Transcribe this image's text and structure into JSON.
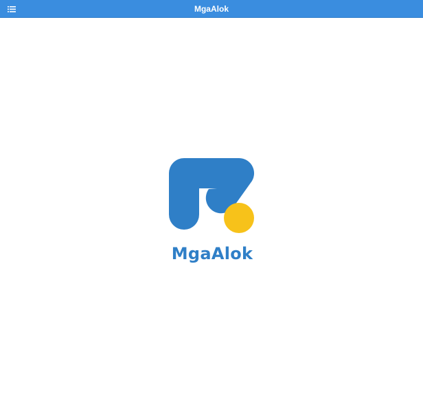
{
  "header": {
    "title": "MgaAlok",
    "menu_icon": "list-menu-icon"
  },
  "splash": {
    "logo_name": "MgaAlok"
  },
  "colors": {
    "topbar": "#3a8ddf",
    "logo_blue": "#2f7fc7",
    "logo_yellow": "#f7c21a",
    "background": "#ffffff"
  }
}
